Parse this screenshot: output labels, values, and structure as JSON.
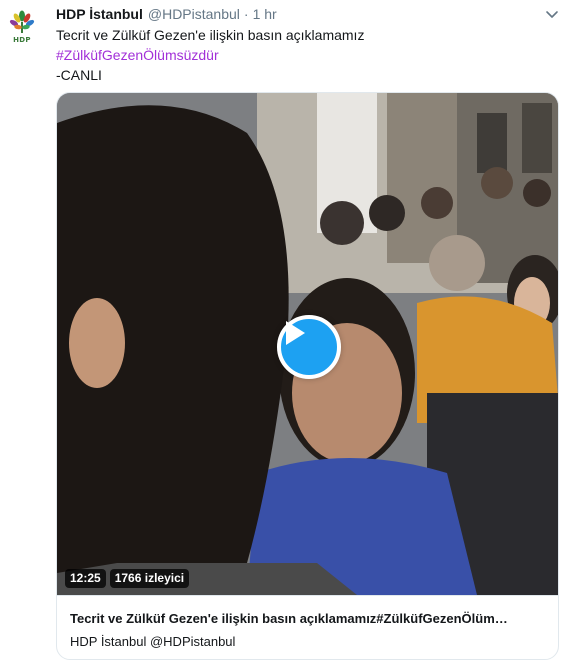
{
  "tweet": {
    "display_name": "HDP İstanbul",
    "handle": "@HDPistanbul",
    "separator": "·",
    "time": "1 hr",
    "avatar_text": "HDP",
    "text_line1": "Tecrit ve Zülküf Gezen'e ilişkin basın açıklamamız",
    "hashtag": "#ZülküfGezenÖlümsüzdür",
    "text_line3": "-CANLI"
  },
  "video": {
    "duration": "12:25",
    "viewers": "1766 izleyici"
  },
  "card": {
    "title": "Tecrit ve Zülküf Gezen'e ilişkin basın açıklamamız#ZülküfGezenÖlüm…",
    "subtitle": "HDP İstanbul @HDPistanbul"
  },
  "icons": {
    "avatar": "hdp-logo-icon",
    "caret": "chevron-down-icon",
    "play": "play-icon"
  },
  "colors": {
    "hashtag": "#a230d8",
    "play_button": "#1da1f2",
    "muted_text": "#657786"
  }
}
